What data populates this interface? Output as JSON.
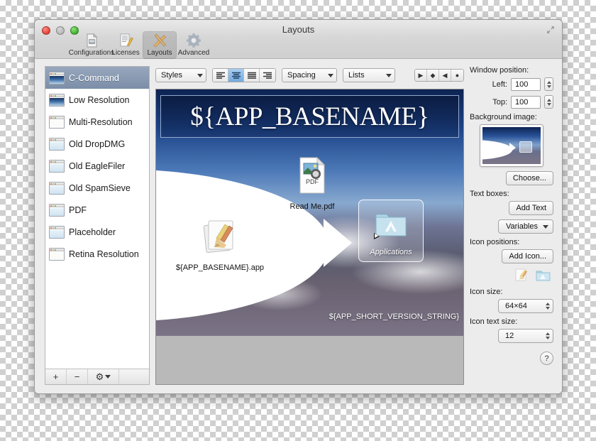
{
  "window": {
    "title": "Layouts",
    "traffic_lights": [
      "close",
      "minimize",
      "zoom"
    ],
    "expand_icon": "fullscreen-icon"
  },
  "toolbar": {
    "items": [
      {
        "label": "Configurations",
        "icon": "configurations-icon",
        "selected": false
      },
      {
        "label": "Licenses",
        "icon": "licenses-icon",
        "selected": false
      },
      {
        "label": "Layouts",
        "icon": "layouts-icon",
        "selected": true
      },
      {
        "label": "Advanced",
        "icon": "advanced-gear-icon",
        "selected": false
      }
    ]
  },
  "sidebar": {
    "items": [
      {
        "label": "C-Command",
        "selected": true,
        "thumb": "sky"
      },
      {
        "label": "Low Resolution",
        "selected": false,
        "thumb": "sky"
      },
      {
        "label": "Multi-Resolution",
        "selected": false,
        "thumb": "paper"
      },
      {
        "label": "Old DropDMG",
        "selected": false,
        "thumb": "lite"
      },
      {
        "label": "Old EagleFiler",
        "selected": false,
        "thumb": "lite"
      },
      {
        "label": "Old SpamSieve",
        "selected": false,
        "thumb": "lite"
      },
      {
        "label": "PDF",
        "selected": false,
        "thumb": "lite"
      },
      {
        "label": "Placeholder",
        "selected": false,
        "thumb": "lite"
      },
      {
        "label": "Retina Resolution",
        "selected": false,
        "thumb": "paper"
      }
    ],
    "footer": {
      "add_label": "+",
      "remove_label": "−",
      "action_label": "⚙"
    }
  },
  "format_bar": {
    "styles_label": "Styles",
    "alignment": {
      "options": [
        "align-left",
        "align-center",
        "align-justify",
        "align-right"
      ],
      "selected_index": 1
    },
    "spacing_label": "Spacing",
    "lists_label": "Lists",
    "nav_buttons": [
      "play-right-icon",
      "diamond-icon",
      "play-left-icon",
      "circle-icon"
    ]
  },
  "canvas": {
    "title_text": "${APP_BASENAME}",
    "version_text": "${APP_SHORT_VERSION_STRING}",
    "items": [
      {
        "name": "readme-pdf",
        "label": "Read Me.pdf",
        "icon": "pdf-document-icon",
        "selected": false
      },
      {
        "name": "app-bundle",
        "label": "${APP_BASENAME}.app",
        "icon": "app-icon",
        "selected": false
      },
      {
        "name": "applications-alias",
        "label": "Applications",
        "icon": "applications-folder-icon",
        "selected": true
      }
    ]
  },
  "inspector": {
    "window_position_label": "Window position:",
    "left_label": "Left:",
    "left_value": "100",
    "top_label": "Top:",
    "top_value": "100",
    "background_image_label": "Background image:",
    "choose_label": "Choose...",
    "text_boxes_label": "Text boxes:",
    "add_text_label": "Add Text",
    "variables_label": "Variables",
    "icon_positions_label": "Icon positions:",
    "add_icon_label": "Add Icon...",
    "position_icons": [
      "app-mini-icon",
      "folder-mini-icon"
    ],
    "icon_size_label": "Icon size:",
    "icon_size_value": "64×64",
    "icon_text_size_label": "Icon text size:",
    "icon_text_size_value": "12",
    "help_label": "?"
  }
}
